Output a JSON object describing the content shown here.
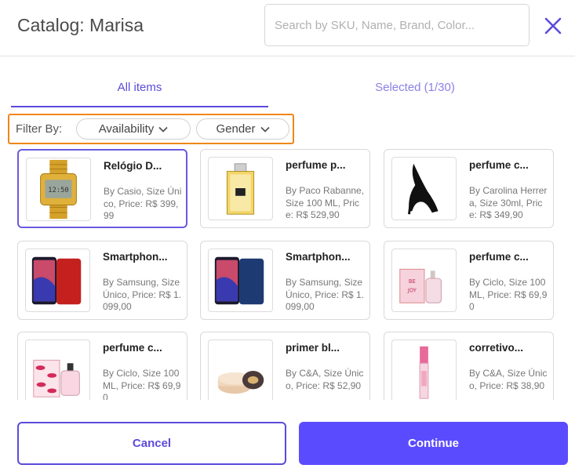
{
  "header": {
    "title": "Catalog: Marisa",
    "search_placeholder": "Search by SKU, Name, Brand, Color..."
  },
  "tabs": [
    {
      "label": "All items",
      "active": true
    },
    {
      "label": "Selected (1/30)",
      "active": false
    }
  ],
  "filter": {
    "label": "Filter By:",
    "options": [
      "Availability",
      "Gender"
    ]
  },
  "products": [
    {
      "name": "Relógio D...",
      "desc": "By Casio, Size Único, Price: R$ 399,99",
      "icon": "gold-watch-icon",
      "selected": true
    },
    {
      "name": "perfume p...",
      "desc": "By Paco Rabanne, Size 100 ML, Price: R$ 529,90",
      "icon": "perfume-bottle-icon",
      "selected": false
    },
    {
      "name": "perfume c...",
      "desc": "By Carolina Herrera, Size 30ml, Price: R$ 349,90",
      "icon": "stiletto-perfume-icon",
      "selected": false
    },
    {
      "name": "Smartphon...",
      "desc": "By Samsung, Size Único, Price: R$ 1.099,00",
      "icon": "red-smartphone-icon",
      "selected": false
    },
    {
      "name": "Smartphon...",
      "desc": "By Samsung, Size Único, Price: R$ 1.099,00",
      "icon": "blue-smartphone-icon",
      "selected": false
    },
    {
      "name": "perfume c...",
      "desc": "By Ciclo, Size 100 ML, Price: R$ 69,90",
      "icon": "pink-perfume-box-icon",
      "selected": false
    },
    {
      "name": "perfume c...",
      "desc": "By Ciclo, Size 100 ML, Price: R$ 69,90",
      "icon": "lips-perfume-box-icon",
      "selected": false
    },
    {
      "name": "primer bl...",
      "desc": "By C&A, Size Único, Price: R$ 52,90",
      "icon": "primer-jar-icon",
      "selected": false
    },
    {
      "name": "corretivo...",
      "desc": "By C&A, Size Único, Price: R$ 38,90",
      "icon": "concealer-tube-icon",
      "selected": false
    }
  ],
  "footer": {
    "cancel_label": "Cancel",
    "continue_label": "Continue"
  },
  "colors": {
    "accent": "#5b4bdb",
    "primary_button": "#5b4bff",
    "highlight_border": "#f0861a"
  }
}
